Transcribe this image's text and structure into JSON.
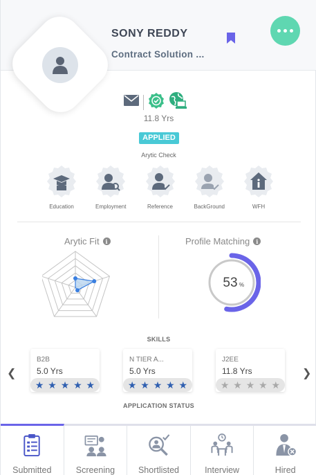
{
  "profile": {
    "name": "SONY REDDY",
    "title": "Contract Solution ...",
    "experience": "11.8 Yrs",
    "status_badge": "APPLIED"
  },
  "arytic_check": {
    "label": "Arytic Check",
    "items": [
      {
        "label": "Education",
        "icon": "graduation-cap-icon"
      },
      {
        "label": "Employment",
        "icon": "employment-search-icon"
      },
      {
        "label": "Reference",
        "icon": "reference-check-icon"
      },
      {
        "label": "BackGround",
        "icon": "background-check-icon"
      },
      {
        "label": "WFH",
        "icon": "home-info-icon"
      }
    ]
  },
  "arytic_fit": {
    "title": "Arytic Fit",
    "radar_values": [
      0.25,
      0.55,
      0.1,
      0.0,
      0.0
    ]
  },
  "profile_matching": {
    "title": "Profile Matching",
    "value": "53",
    "unit": "%",
    "percent": 53
  },
  "skills": {
    "label": "SKILLS",
    "items": [
      {
        "name": "B2B",
        "years": "5.0 Yrs",
        "rating": 5
      },
      {
        "name": "N TIER A...",
        "years": "5.0 Yrs",
        "rating": 5
      },
      {
        "name": "J2EE",
        "years": "11.8 Yrs",
        "rating": 0
      }
    ]
  },
  "application_status": {
    "label": "APPLICATION STATUS",
    "tabs": [
      {
        "label": "Submitted",
        "icon": "clipboard-icon",
        "active": true
      },
      {
        "label": "Screening",
        "icon": "screening-icon",
        "active": false
      },
      {
        "label": "Shortlisted",
        "icon": "magnifier-check-icon",
        "active": false
      },
      {
        "label": "Interview",
        "icon": "interview-icon",
        "active": false
      },
      {
        "label": "Hired",
        "icon": "hired-person-icon",
        "active": false
      }
    ]
  },
  "colors": {
    "accent": "#6a64e8",
    "green": "#5fd7b1",
    "applied": "#49c9d6",
    "star_on": "#2f5fb0",
    "radar_fill": "#b8d4f0",
    "radar_point": "#3a7fe0"
  }
}
